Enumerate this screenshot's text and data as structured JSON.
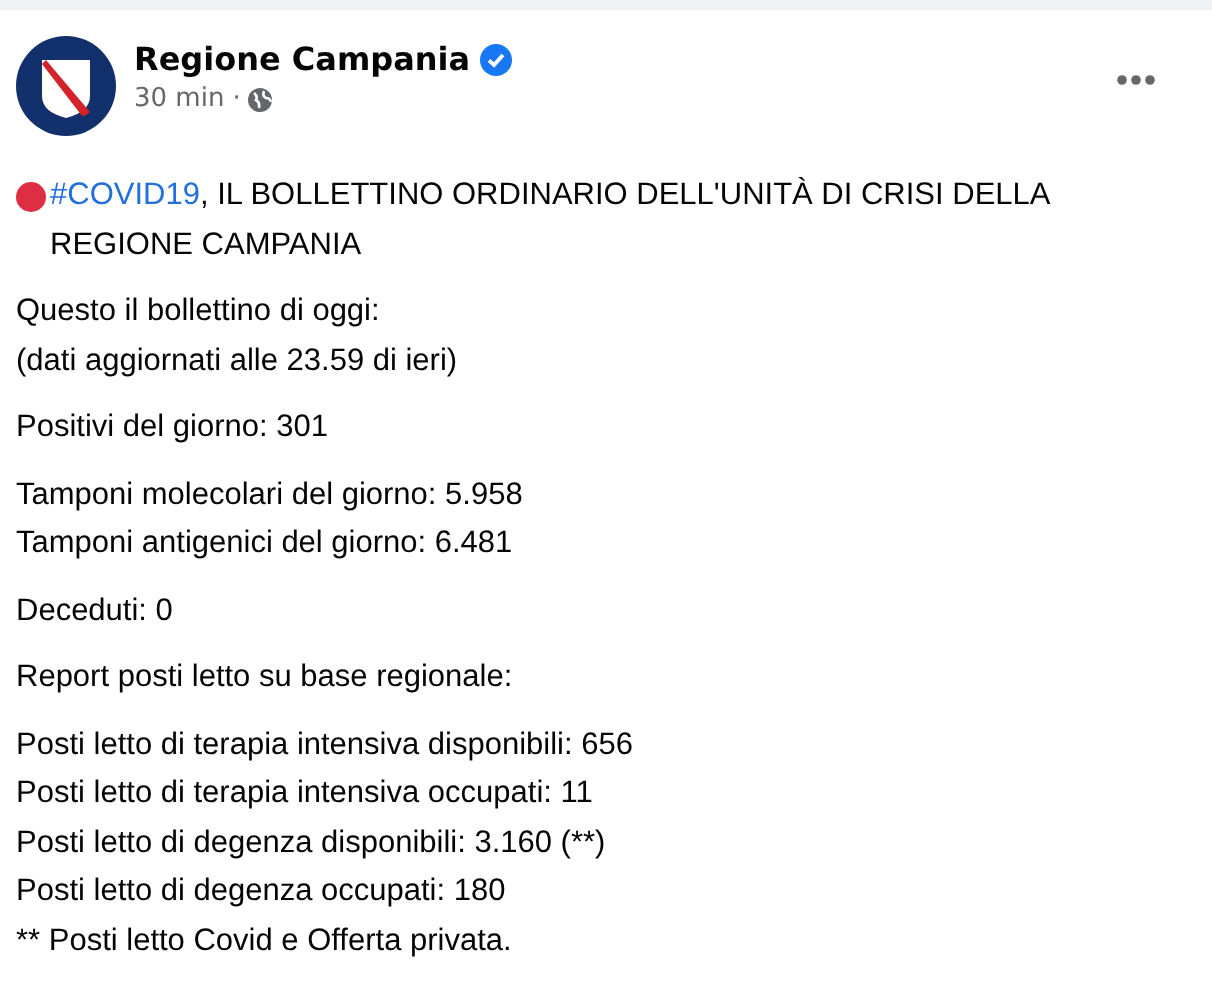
{
  "post": {
    "author": "Regione Campania",
    "verified": true,
    "time": "30 min",
    "separator": "·",
    "headline": {
      "hashtag": "#COVID19",
      "text": ", IL BOLLETTINO ORDINARIO DELL'UNITÀ DI CRISI DELLA REGIONE CAMPANIA"
    },
    "paragraphs": [
      [
        "Questo il bollettino di oggi:",
        "(dati aggiornati alle 23.59 di ieri)"
      ],
      [
        "Positivi del giorno: 301"
      ],
      [
        "Tamponi molecolari del giorno: 5.958",
        "Tamponi antigenici del giorno: 6.481"
      ],
      [
        "Deceduti: 0"
      ],
      [
        "Report posti letto su base regionale:"
      ],
      [
        "Posti letto di terapia intensiva disponibili: 656",
        "Posti letto di terapia intensiva occupati: 11",
        "Posti letto di degenza disponibili: 3.160 (**)",
        "Posti letto di degenza occupati: 180",
        "** Posti letto Covid e Offerta privata."
      ]
    ]
  }
}
